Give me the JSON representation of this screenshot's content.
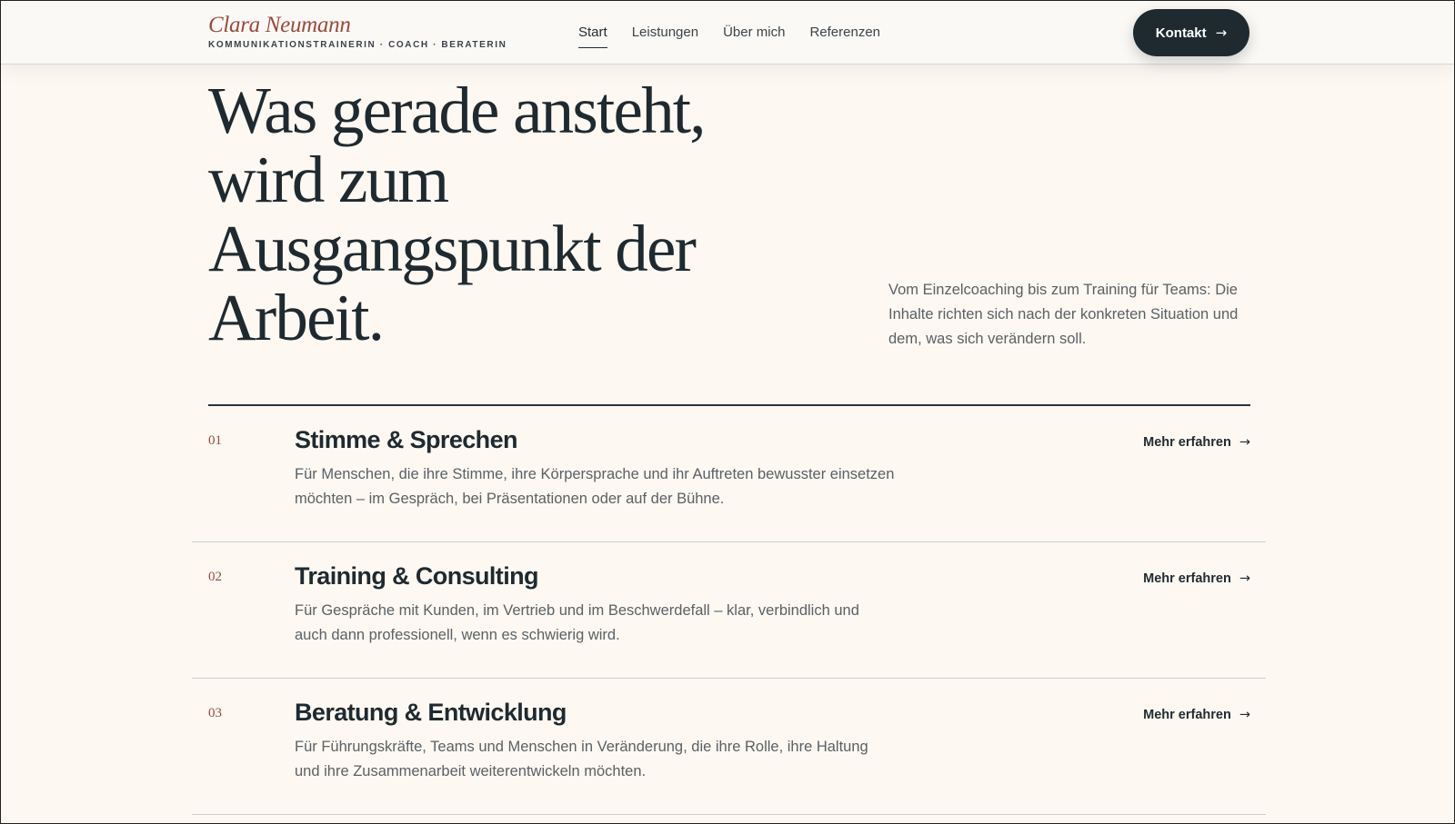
{
  "brand": {
    "name": "Clara Neumann",
    "tagline": "KOMMUNIKATIONSTRAINERIN · COACH · BERATERIN",
    "accent_color": "#9a4a3a"
  },
  "nav": {
    "items": [
      {
        "label": "Start",
        "active": true
      },
      {
        "label": "Leistungen",
        "active": false
      },
      {
        "label": "Über mich",
        "active": false
      },
      {
        "label": "Referenzen",
        "active": false
      }
    ],
    "cta_label": "Kontakt",
    "arrow": "→"
  },
  "hero": {
    "headline_lines": [
      "Was gerade ansteht,",
      "wird zum",
      "Ausgangspunkt der",
      "Arbeit."
    ],
    "intro": "Vom Einzelcoaching bis zum Training für Teams: Die Inhalte richten sich nach der konkreten Situation und dem, was sich verändern soll."
  },
  "services": [
    {
      "number": "01",
      "title": "Stimme & Sprechen",
      "description": "Für Menschen, die ihre Stimme, ihre Körpersprache und ihr Auftreten bewusster einsetzen möchten – im Gespräch, bei Präsentationen oder auf der Bühne.",
      "link_label": "Mehr erfahren"
    },
    {
      "number": "02",
      "title": "Training & Consulting",
      "description": "Für Gespräche mit Kunden, im Vertrieb und im Beschwerdefall – klar, verbindlich und auch dann professionell, wenn es schwierig wird.",
      "link_label": "Mehr erfahren"
    },
    {
      "number": "03",
      "title": "Beratung & Entwicklung",
      "description": "Für Führungskräfte, Teams und Menschen in Veränderung, die ihre Rolle, ihre Haltung und ihre Zusammenarbeit weiterentwickeln möchten.",
      "link_label": "Mehr erfahren"
    }
  ],
  "colors": {
    "background": "#fdf8f2",
    "text_dark": "#1f2a30",
    "text_muted": "#5a6166"
  }
}
